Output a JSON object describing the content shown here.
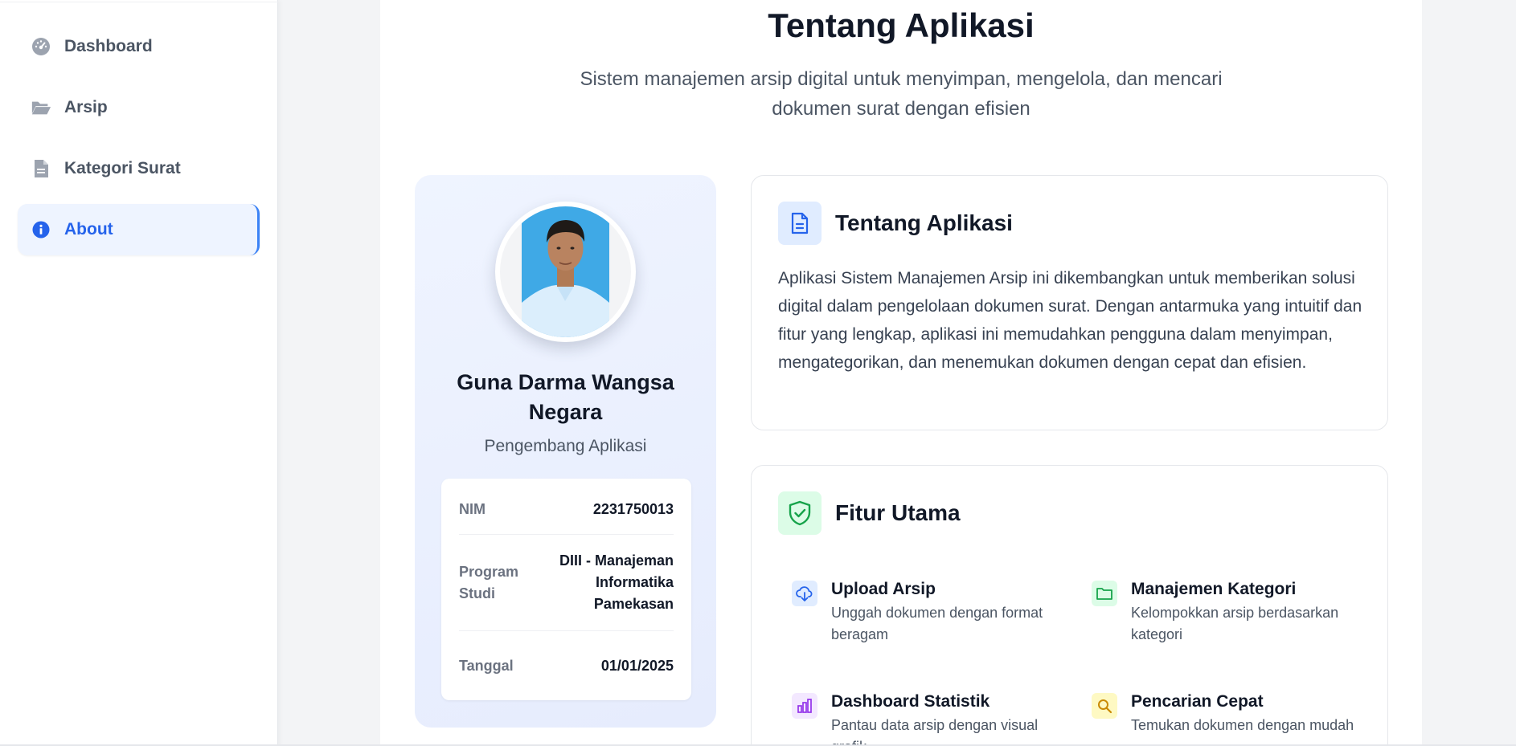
{
  "sidebar": {
    "items": [
      {
        "label": "Dashboard",
        "icon": "dashboard-gauge-icon",
        "active": false
      },
      {
        "label": "Arsip",
        "icon": "folder-open-icon",
        "active": false
      },
      {
        "label": "Kategori Surat",
        "icon": "document-icon",
        "active": false
      },
      {
        "label": "About",
        "icon": "info-circle-icon",
        "active": true
      }
    ]
  },
  "page": {
    "title": "Tentang Aplikasi",
    "subtitle": "Sistem manajemen arsip digital untuk menyimpan, mengelola, dan mencari dokumen surat dengan efisien"
  },
  "profile": {
    "name": "Guna Darma Wangsa Negara",
    "role": "Pengembang Aplikasi",
    "info": [
      {
        "key": "NIM",
        "value": "2231750013"
      },
      {
        "key": "Program Studi",
        "value": "DIII - Manajeman Informatika Pamekasan"
      },
      {
        "key": "Tanggal",
        "value": "01/01/2025"
      }
    ]
  },
  "about_card": {
    "title": "Tentang Aplikasi",
    "text": "Aplikasi Sistem Manajemen Arsip ini dikembangkan untuk memberikan solusi digital dalam pengelolaan dokumen surat. Dengan antarmuka yang intuitif dan fitur yang lengkap, aplikasi ini memudahkan pengguna dalam menyimpan, mengategorikan, dan menemukan dokumen dengan cepat dan efisien."
  },
  "features_card": {
    "title": "Fitur Utama",
    "items": [
      {
        "title": "Upload Arsip",
        "desc": "Unggah dokumen dengan format beragam",
        "icon": "cloud-download-icon",
        "color": "#2563eb",
        "bg": "#e0ecff"
      },
      {
        "title": "Manajemen Kategori",
        "desc": "Kelompokkan arsip berdasarkan kategori",
        "icon": "folder-icon",
        "color": "#16a34a",
        "bg": "#dcfce7"
      },
      {
        "title": "Dashboard Statistik",
        "desc": "Pantau data arsip dengan visual grafik",
        "icon": "bar-chart-icon",
        "color": "#9333ea",
        "bg": "#f3e8ff"
      },
      {
        "title": "Pencarian Cepat",
        "desc": "Temukan dokumen dengan mudah",
        "icon": "search-icon",
        "color": "#ca8a04",
        "bg": "#fef9c3"
      }
    ]
  },
  "colors": {
    "accent": "#2563eb",
    "active_bg": "#eef4ff",
    "profile_bg": "#e9effe"
  }
}
